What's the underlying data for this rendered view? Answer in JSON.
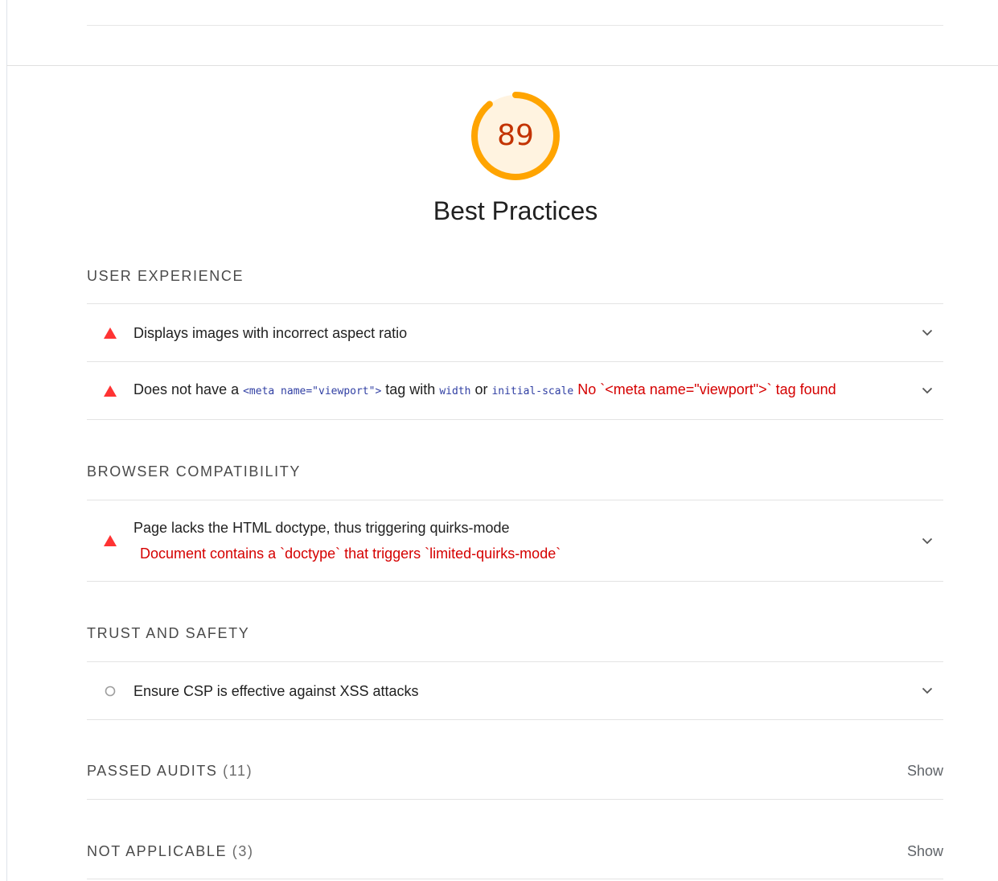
{
  "category": {
    "score": "89",
    "score_fraction": 0.89,
    "title": "Best Practices",
    "gauge_color": "#ffa400",
    "gauge_fill": "#fff3e0",
    "score_color": "#c33300"
  },
  "groups": {
    "user_experience": {
      "title": "User Experience",
      "audits": [
        {
          "icon": "fail-triangle-icon",
          "title": "Displays images with incorrect aspect ratio"
        },
        {
          "icon": "fail-triangle-icon",
          "title_pre": "Does not have a ",
          "code_1": "<meta name=\"viewport\">",
          "title_mid": " tag with ",
          "code_2": "width",
          "title_or": " or ",
          "code_3": "initial-scale",
          "error": " No `<meta name=\"viewport\">` tag found"
        }
      ]
    },
    "browser_compatibility": {
      "title": "Browser Compatibility",
      "audits": [
        {
          "icon": "fail-triangle-icon",
          "title": "Page lacks the HTML doctype, thus triggering quirks-mode",
          "error": "Document contains a `doctype` that triggers `limited-quirks-mode`"
        }
      ]
    },
    "trust_and_safety": {
      "title": "Trust and Safety",
      "audits": [
        {
          "icon": "informative-circle-icon",
          "title": "Ensure CSP is effective against XSS attacks"
        }
      ]
    }
  },
  "passed": {
    "title": "Passed audits",
    "count": "(11)",
    "action": "Show"
  },
  "not_applicable": {
    "title": "Not applicable",
    "count": "(3)",
    "action": "Show"
  },
  "colors": {
    "fail": "#ff3333",
    "error_text": "#d50000",
    "code_text": "#303fa3"
  }
}
